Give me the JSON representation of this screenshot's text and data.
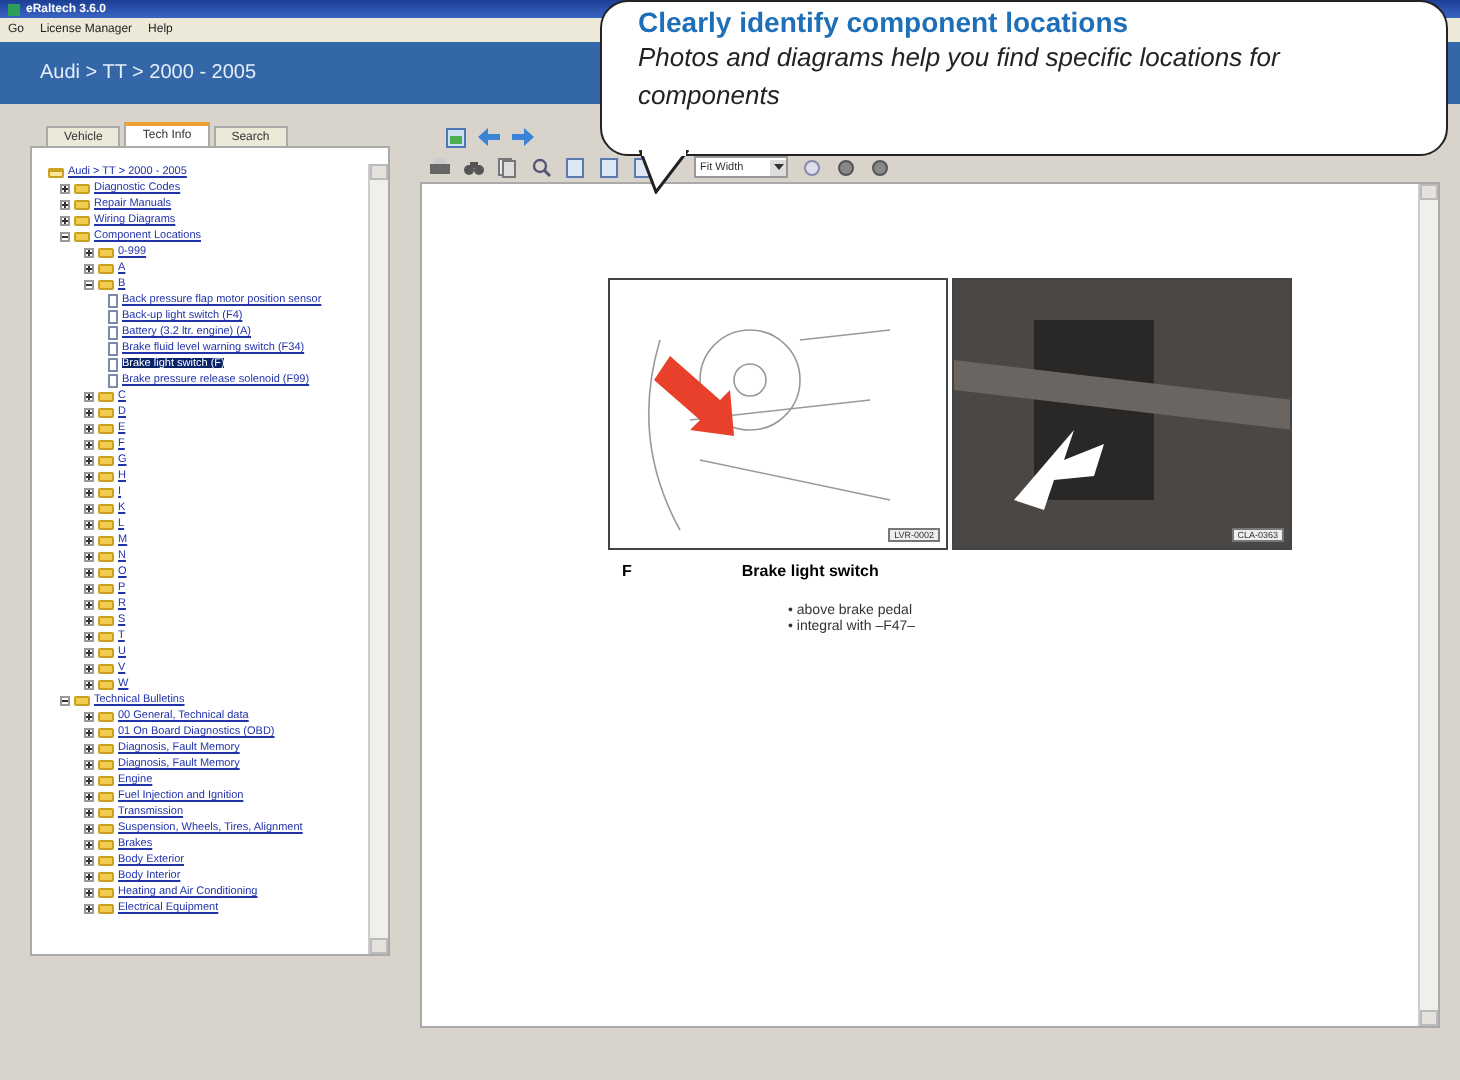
{
  "window": {
    "title": "eRaltech 3.6.0"
  },
  "menu": [
    "Go",
    "License Manager",
    "Help"
  ],
  "breadcrumb": "Audi > TT > 2000 - 2005",
  "tabs": [
    {
      "label": "Vehicle",
      "selected": false
    },
    {
      "label": "Tech Info",
      "selected": true
    },
    {
      "label": "Search",
      "selected": false
    }
  ],
  "tree": [
    {
      "label": "Audi > TT > 2000 - 2005",
      "kind": "root",
      "expanded": true,
      "selected": false,
      "children": [
        {
          "label": "Diagnostic Codes",
          "kind": "folder",
          "expanded": false,
          "selected": false
        },
        {
          "label": "Repair Manuals",
          "kind": "folder",
          "expanded": false,
          "selected": false
        },
        {
          "label": "Wiring Diagrams",
          "kind": "folder",
          "expanded": false,
          "selected": false
        },
        {
          "label": "Component Locations",
          "kind": "folder",
          "expanded": true,
          "selected": false,
          "children": [
            {
              "label": "0-999",
              "kind": "folder",
              "expanded": false,
              "selected": false
            },
            {
              "label": "A",
              "kind": "folder",
              "expanded": false,
              "selected": false
            },
            {
              "label": "B",
              "kind": "folder",
              "expanded": true,
              "selected": false,
              "children": [
                {
                  "label": "Back pressure flap motor position sensor",
                  "kind": "page",
                  "selected": false
                },
                {
                  "label": "Back-up light switch (F4)",
                  "kind": "page",
                  "selected": false
                },
                {
                  "label": "Battery (3.2 ltr. engine) (A)",
                  "kind": "page",
                  "selected": false
                },
                {
                  "label": "Brake fluid level warning switch (F34)",
                  "kind": "page",
                  "selected": false
                },
                {
                  "label": "Brake light switch (F)",
                  "kind": "page",
                  "selected": true
                },
                {
                  "label": "Brake pressure release solenoid (F99)",
                  "kind": "page",
                  "selected": false
                }
              ]
            },
            {
              "label": "C",
              "kind": "folder",
              "expanded": false,
              "selected": false
            },
            {
              "label": "D",
              "kind": "folder",
              "expanded": false,
              "selected": false
            },
            {
              "label": "E",
              "kind": "folder",
              "expanded": false,
              "selected": false
            },
            {
              "label": "F",
              "kind": "folder",
              "expanded": false,
              "selected": false
            },
            {
              "label": "G",
              "kind": "folder",
              "expanded": false,
              "selected": false
            },
            {
              "label": "H",
              "kind": "folder",
              "expanded": false,
              "selected": false
            },
            {
              "label": "I",
              "kind": "folder",
              "expanded": false,
              "selected": false
            },
            {
              "label": "K",
              "kind": "folder",
              "expanded": false,
              "selected": false
            },
            {
              "label": "L",
              "kind": "folder",
              "expanded": false,
              "selected": false
            },
            {
              "label": "M",
              "kind": "folder",
              "expanded": false,
              "selected": false
            },
            {
              "label": "N",
              "kind": "folder",
              "expanded": false,
              "selected": false
            },
            {
              "label": "O",
              "kind": "folder",
              "expanded": false,
              "selected": false
            },
            {
              "label": "P",
              "kind": "folder",
              "expanded": false,
              "selected": false
            },
            {
              "label": "R",
              "kind": "folder",
              "expanded": false,
              "selected": false
            },
            {
              "label": "S",
              "kind": "folder",
              "expanded": false,
              "selected": false
            },
            {
              "label": "T",
              "kind": "folder",
              "expanded": false,
              "selected": false
            },
            {
              "label": "U",
              "kind": "folder",
              "expanded": false,
              "selected": false
            },
            {
              "label": "V",
              "kind": "folder",
              "expanded": false,
              "selected": false
            },
            {
              "label": "W",
              "kind": "folder",
              "expanded": false,
              "selected": false
            }
          ]
        },
        {
          "label": "Technical Bulletins",
          "kind": "folder",
          "expanded": true,
          "selected": false,
          "children": [
            {
              "label": "00 General, Technical data",
              "kind": "folder",
              "expanded": false,
              "selected": false
            },
            {
              "label": "01 On Board Diagnostics (OBD)",
              "kind": "folder",
              "expanded": false,
              "selected": false
            },
            {
              "label": "Diagnosis, Fault Memory",
              "kind": "folder",
              "expanded": false,
              "selected": false
            },
            {
              "label": "Diagnosis, Fault Memory",
              "kind": "folder",
              "expanded": false,
              "selected": false
            },
            {
              "label": "Engine",
              "kind": "folder",
              "expanded": false,
              "selected": false
            },
            {
              "label": "Fuel Injection and Ignition",
              "kind": "folder",
              "expanded": false,
              "selected": false
            },
            {
              "label": "Transmission",
              "kind": "folder",
              "expanded": false,
              "selected": false
            },
            {
              "label": "Suspension, Wheels, Tires, Alignment",
              "kind": "folder",
              "expanded": false,
              "selected": false
            },
            {
              "label": "Brakes",
              "kind": "folder",
              "expanded": false,
              "selected": false
            },
            {
              "label": "Body Exterior",
              "kind": "folder",
              "expanded": false,
              "selected": false
            },
            {
              "label": "Body Interior",
              "kind": "folder",
              "expanded": false,
              "selected": false
            },
            {
              "label": "Heating and Air Conditioning",
              "kind": "folder",
              "expanded": false,
              "selected": false
            },
            {
              "label": "Electrical Equipment",
              "kind": "folder",
              "expanded": false,
              "selected": false
            }
          ]
        }
      ]
    }
  ],
  "zoom_select": {
    "value": "Fit Width"
  },
  "document": {
    "figures": [
      {
        "kind": "drawing",
        "code": "LVR-0002"
      },
      {
        "kind": "photo",
        "code": "CLA-0363"
      }
    ],
    "code": "F",
    "title": "Brake light switch",
    "bullets": [
      "• above brake pedal",
      "• integral with –F47–"
    ]
  },
  "callout": {
    "title": "Clearly identify component locations",
    "text": "Photos and diagrams help you find specific locations for components"
  }
}
